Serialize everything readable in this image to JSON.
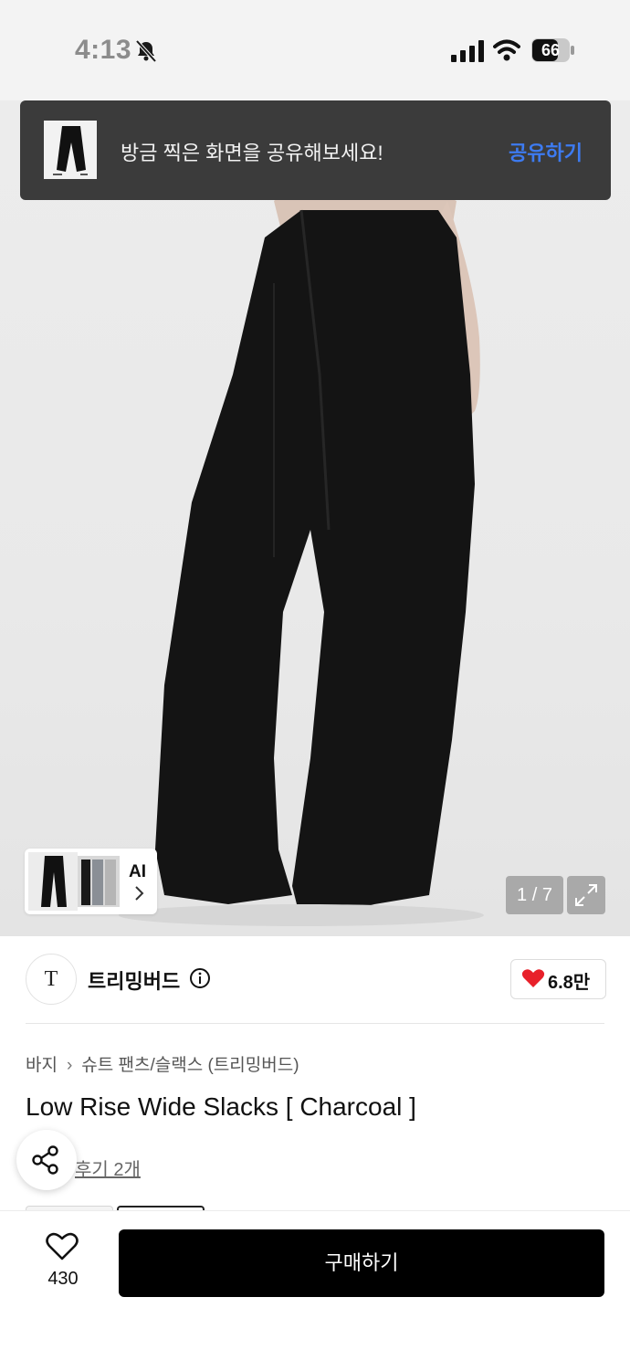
{
  "status_bar": {
    "time": "4:13",
    "battery": "66",
    "icons": [
      "bell-muted-icon",
      "signal-icon",
      "wifi-icon",
      "battery-icon"
    ]
  },
  "toast": {
    "message": "방금 찍은 화면을 공유해보세요!",
    "action": "공유하기",
    "action_color": "#3d7bf1"
  },
  "gallery": {
    "counter": "1 / 7",
    "ai_label": "AI",
    "icons": [
      "expand-icon",
      "chevron-right-icon"
    ]
  },
  "brand": {
    "logo_text": "T",
    "name": "트리밍버드",
    "likes": "6.8만",
    "icons": [
      "info-icon",
      "heart-icon"
    ],
    "heart_color": "#e8202a"
  },
  "product": {
    "breadcrumb": [
      "바지",
      "슈트 팬츠/슬랙스 (트리밍버드)"
    ],
    "title": "Low Rise Wide Slacks [ Charcoal ]",
    "review_link": "후기 2개"
  },
  "bottom_bar": {
    "wishlist_count": "430",
    "buy_label": "구매하기",
    "icons": [
      "heart-outline-icon",
      "share-icon"
    ]
  }
}
